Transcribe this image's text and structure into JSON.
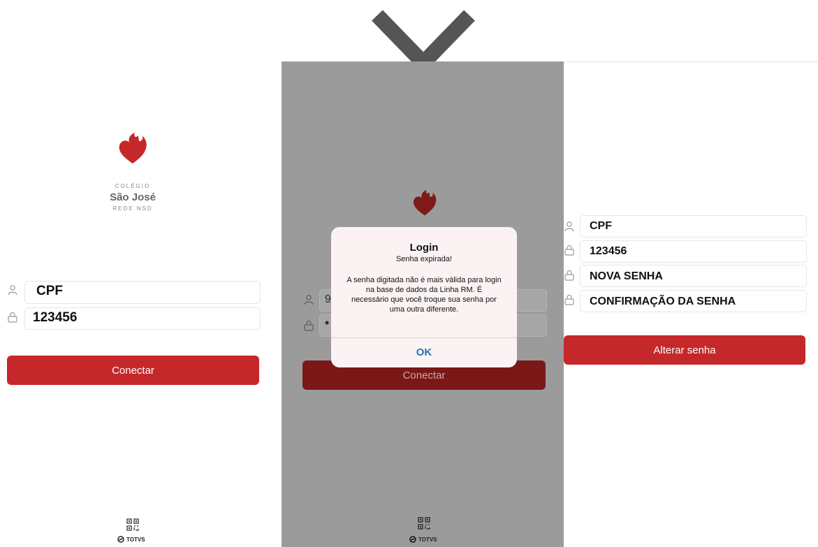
{
  "left_panel": {
    "brand": {
      "top_text": "COLÉGIO",
      "name": "São José",
      "bottom_text": "REDE NSD"
    },
    "cpf_field": {
      "value": "CPF"
    },
    "password_field": {
      "value": "123456"
    },
    "connect_button": {
      "label": "Conectar"
    },
    "qr_icon": "qr-code-icon",
    "footer_brand": "TOTVS"
  },
  "middle_panel": {
    "cpf_field_partial": "9",
    "password_field_partial": "•",
    "connect_button": {
      "label": "Conectar"
    },
    "qr_icon": "qr-code-icon",
    "footer_brand": "TOTVS",
    "dialog": {
      "title": "Login",
      "subtitle": "Senha expirada!",
      "message": "A senha digitada não é mais válida para login na base de dados da Linha RM. É necessário que você troque sua senha por uma outra diferente.",
      "ok_label": "OK"
    }
  },
  "right_panel": {
    "fields": [
      {
        "value": "CPF"
      },
      {
        "value": "123456"
      },
      {
        "value": "NOVA SENHA"
      },
      {
        "value": "CONFIRMAÇÃO DA SENHA"
      }
    ],
    "change_password_button": {
      "label": "Alterar senha"
    }
  },
  "colors": {
    "brand_red": "#c5282a",
    "overlay_gray": "#9b9b9b",
    "ok_blue": "#2e6fc0"
  }
}
